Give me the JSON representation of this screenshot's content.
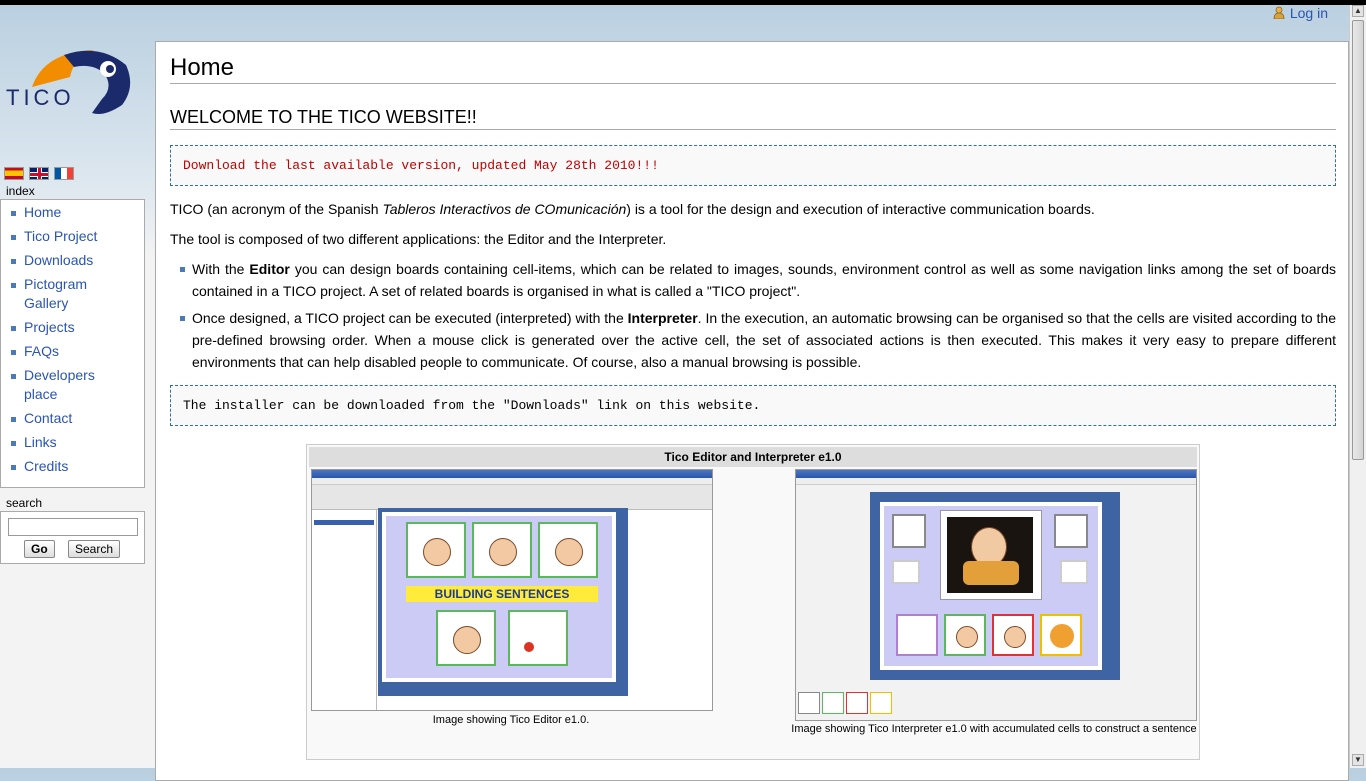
{
  "header": {
    "login_label": "Log in",
    "user_icon": "user-icon"
  },
  "logo": {
    "text": "TICO"
  },
  "languages": [
    "es",
    "en",
    "fr"
  ],
  "sidebar": {
    "index_label": "index",
    "items": [
      {
        "label": "Home"
      },
      {
        "label": "Tico Project"
      },
      {
        "label": "Downloads"
      },
      {
        "label": "Pictogram Gallery"
      },
      {
        "label": "Projects"
      },
      {
        "label": "FAQs"
      },
      {
        "label": "Developers place"
      },
      {
        "label": "Contact"
      },
      {
        "label": "Links"
      },
      {
        "label": "Credits"
      }
    ],
    "search_label": "search",
    "search_value": "",
    "go_label": "Go",
    "search_button_label": "Search"
  },
  "content": {
    "page_title": "Home",
    "section_title": "WELCOME TO THE TICO WEBSITE!!",
    "download_notice": "Download the last available version, updated May 28th 2010!!!",
    "intro_pre": "TICO (an acronym of the Spanish ",
    "intro_em": "Tableros Interactivos de COmunicación",
    "intro_post": ") is a tool for the design and execution of interactive communication boards.",
    "composed": "The tool is composed of two different applications: the Editor and the Interpreter.",
    "bullet1_pre": "With the ",
    "bullet1_bold": "Editor",
    "bullet1_post": " you can design boards containing cell-items, which can be related to images, sounds, environment control as well as some navigation links among the set of boards contained in a TICO project. A set of related boards is organised in what is called a \"TICO project\".",
    "bullet2_pre": "Once designed, a TICO project can be executed (interpreted) with the ",
    "bullet2_bold": "Interpreter",
    "bullet2_post": ". In the execution, an automatic browsing can be organised so that the cells are visited according to the pre-defined browsing order. When a mouse click is generated over the active cell, the set of associated actions is then executed. This makes it very easy to prepare different environments that can help disabled people to communicate. Of course, also a manual browsing is possible.",
    "installer_notice": "The installer can be downloaded from the \"Downloads\" link on this website."
  },
  "gallery": {
    "title": "Tico Editor and Interpreter e1.0",
    "editor_banner": "BUILDING SENTENCES",
    "caption_editor": "Image showing Tico Editor e1.0.",
    "caption_interpreter": "Image showing Tico Interpreter e1.0 with accumulated cells to construct a sentence"
  },
  "colors": {
    "link": "#2a55b0",
    "notice_red": "#c00000",
    "board_blue": "#3f64a4",
    "bullet": "#4a7ab7"
  }
}
